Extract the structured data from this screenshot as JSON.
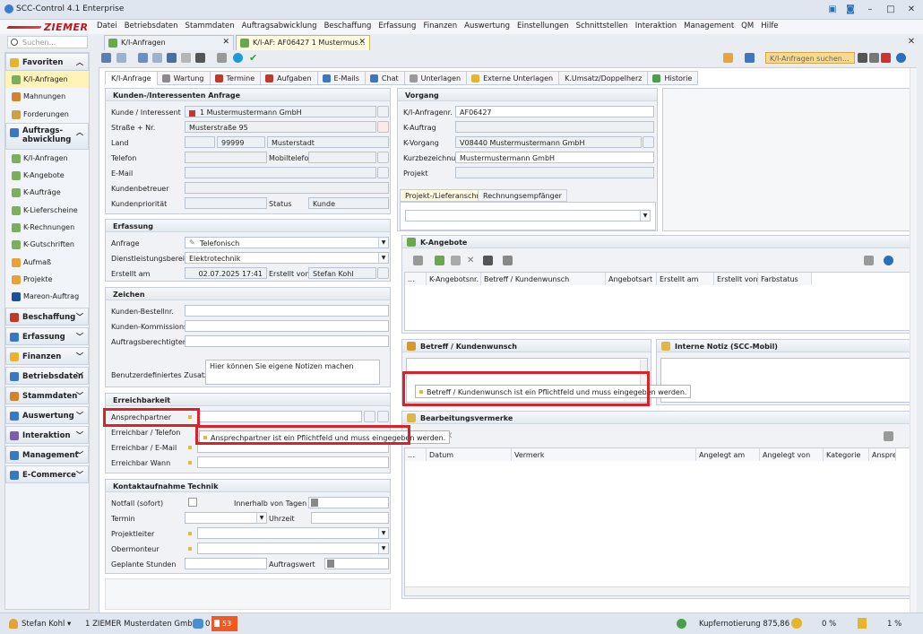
{
  "app": {
    "title": "SCC-Control 4.1 Enterprise",
    "logo": "ZIEMER"
  },
  "menu": [
    "Datei",
    "Betriebsdaten",
    "Stammdaten",
    "Auftragsabwicklung",
    "Beschaffung",
    "Erfassung",
    "Finanzen",
    "Auswertung",
    "Einstellungen",
    "Schnittstellen",
    "Interaktion",
    "Management",
    "QM",
    "Hilfe"
  ],
  "search_placeholder": "Suchen...",
  "doc_tabs": [
    {
      "label": "K/I-Anfragen"
    },
    {
      "label": "K/I-AF: AF06427 1 Mustermus..."
    }
  ],
  "sidebar": {
    "groups": [
      {
        "label": "Favoriten",
        "items": [
          "K/I-Anfragen",
          "Mahnungen",
          "Forderungen"
        ]
      },
      {
        "label": "Auftrags-abwicklung",
        "items": [
          "K/I-Anfragen",
          "K-Angebote",
          "K-Aufträge",
          "K-Lieferscheine",
          "K-Rechnungen",
          "K-Gutschriften",
          "Aufmaß",
          "Projekte",
          "Mareon-Auftrag"
        ]
      }
    ],
    "collapsed": [
      "Beschaffung",
      "Erfassung",
      "Finanzen",
      "Betriebsdaten",
      "Stammdaten",
      "Auswertung",
      "Interaktion",
      "Management",
      "E-Commerce"
    ]
  },
  "toolbar": {
    "search_placeholder": "K/I-Anfragen suchen..."
  },
  "inner_tabs": [
    "K/I-Anfrage",
    "Wartung",
    "Termine",
    "Aufgaben",
    "E-Mails",
    "Chat",
    "Unterlagen",
    "Externe Unterlagen",
    "K.Umsatz/Doppelherz",
    "Historie"
  ],
  "kunden": {
    "title": "Kunden-/Interessenten Anfrage",
    "kunde_label": "Kunde / Interessent",
    "kunde": "1 Mustermustermann GmbH",
    "strasse_label": "Straße + Nr.",
    "strasse": "Musterstraße 95",
    "land_label": "Land",
    "plz": "99999",
    "ort": "Musterstadt",
    "telefon_label": "Telefon",
    "mobil_label": "Mobiltelefon",
    "email_label": "E-Mail",
    "betreuer_label": "Kundenbetreuer",
    "prio_label": "Kundenpriorität",
    "status_label": "Status",
    "status": "Kunde"
  },
  "vorgang": {
    "title": "Vorgang",
    "nr_label": "K/I-Anfragenr.",
    "nr": "AF06427",
    "auftrag_label": "K-Auftrag",
    "kvorgang_label": "K-Vorgang",
    "kvorgang": "V08440 Mustermustermann GmbH",
    "kurz_label": "Kurzbezeichnung",
    "kurz": "Mustermustermann GmbH",
    "projekt_label": "Projekt",
    "subtabs": [
      "Projekt-/Lieferanschrift",
      "Rechnungsempfänger"
    ]
  },
  "erfassung": {
    "title": "Erfassung",
    "anfrage_label": "Anfrage",
    "anfrage": "Telefonisch",
    "dienst_label": "Dienstleistungsbereich",
    "dienst": "Elektrotechnik",
    "erstellt_label": "Erstellt am",
    "erstellt": "02.07.2025 17:41",
    "von_label": "Erstellt von",
    "von": "Stefan Kohl"
  },
  "zeichen": {
    "title": "Zeichen",
    "bestell_label": "Kunden-Bestellnr.",
    "kommission_label": "Kunden-Kommissionsnr.",
    "berechtigt_label": "Auftragsberechtigter",
    "zusatz_label": "Benutzerdefiniertes Zusatzfeld",
    "zusatz": "Hier können Sie eigene Notizen machen"
  },
  "erreichbarkeit": {
    "title": "Erreichbarkeit",
    "ansprech_label": "Ansprechpartner",
    "tel_label": "Erreichbar / Telefon",
    "mail_label": "Erreichbar / E-Mail",
    "wann_label": "Erreichbar Wann",
    "tooltip": "Ansprechpartner ist ein Pflichtfeld und muss eingegeben werden."
  },
  "kontakt": {
    "title": "Kontaktaufnahme Technik",
    "notfall_label": "Notfall (sofort)",
    "tage_label": "Innerhalb von Tagen",
    "termin_label": "Termin",
    "uhrzeit_label": "Uhrzeit",
    "projektleiter_label": "Projektleiter",
    "obermonteur_label": "Obermonteur",
    "stunden_label": "Geplante Stunden",
    "auftragswert_label": "Auftragswert"
  },
  "angebote": {
    "title": "K-Angebote",
    "columns": [
      "...",
      "K-Angebotsnr.",
      "Betreff / Kundenwunsch",
      "Angebotsart",
      "Erstellt am",
      "Erstellt von",
      "Farbstatus"
    ]
  },
  "betreff": {
    "title": "Betreff / Kundenwunsch",
    "tooltip": "Betreff / Kundenwunsch ist ein Pflichtfeld und muss eingegeben werden."
  },
  "notiz": {
    "title": "Interne Notiz (SCC-Mobil)"
  },
  "vermerke": {
    "title": "Bearbeitungsvermerke",
    "columns": [
      "...",
      "Datum",
      "Vermerk",
      "Angelegt am",
      "Angelegt von",
      "Kategorie",
      "Anspre"
    ]
  },
  "status": {
    "user": "Stefan Kohl",
    "company": "1 ZIEMER Musterdaten GmbH",
    "count1": "0",
    "warnings": "53",
    "kupfer": "Kupfernotierung 875,86 €",
    "pct1": "0 %",
    "pct2": "1 %"
  }
}
